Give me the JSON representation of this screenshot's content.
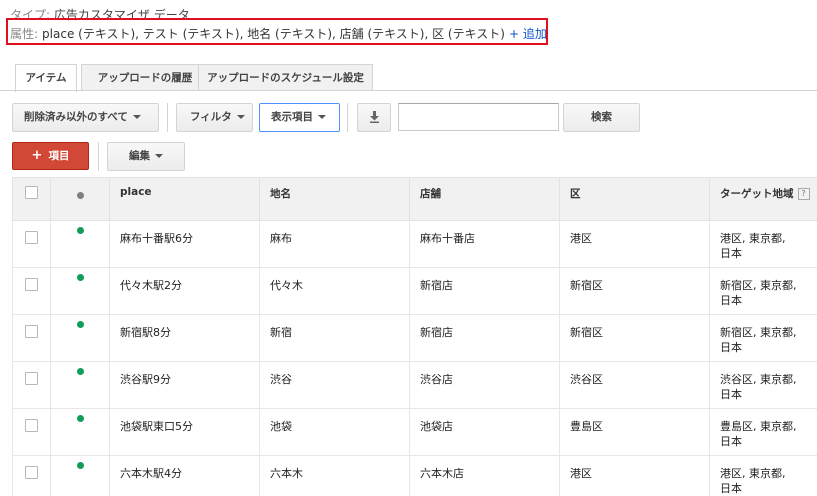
{
  "type_line": {
    "label": "タイプ:",
    "value": "広告カスタマイザ データ"
  },
  "attributes": {
    "label": "属性:",
    "value": "place (テキスト), テスト (テキスト), 地名 (テキスト), 店舗 (テキスト), 区 (テキスト)",
    "add_link": "+ 追加"
  },
  "tabs": [
    {
      "label": "アイテム",
      "active": true
    },
    {
      "label": "アップロードの履歴",
      "active": false
    },
    {
      "label": "アップロードのスケジュール設定",
      "active": false
    }
  ],
  "toolbar": {
    "filter_scope": "削除済み以外のすべて",
    "filter": "フィルタ",
    "columns": "表示項目",
    "search": "検索",
    "search_value": "",
    "add_item": "項目",
    "edit": "編集"
  },
  "table": {
    "headers": [
      "place",
      "地名",
      "店舗",
      "区",
      "ターゲット地域"
    ],
    "help_label": "?",
    "rows": [
      {
        "place": "麻布十番駅6分",
        "chimei": "麻布",
        "tenpo": "麻布十番店",
        "ku": "港区",
        "target_1": "港区, 東京都,",
        "target_2": "日本"
      },
      {
        "place": "代々木駅2分",
        "chimei": "代々木",
        "tenpo": "新宿店",
        "ku": "新宿区",
        "target_1": "新宿区, 東京都,",
        "target_2": "日本"
      },
      {
        "place": "新宿駅8分",
        "chimei": "新宿",
        "tenpo": "新宿店",
        "ku": "新宿区",
        "target_1": "新宿区, 東京都,",
        "target_2": "日本"
      },
      {
        "place": "渋谷駅9分",
        "chimei": "渋谷",
        "tenpo": "渋谷店",
        "ku": "渋谷区",
        "target_1": "渋谷区, 東京都,",
        "target_2": "日本"
      },
      {
        "place": "池袋駅東口5分",
        "chimei": "池袋",
        "tenpo": "池袋店",
        "ku": "豊島区",
        "target_1": "豊島区, 東京都,",
        "target_2": "日本"
      },
      {
        "place": "六本木駅4分",
        "chimei": "六本木",
        "tenpo": "六本木店",
        "ku": "港区",
        "target_1": "港区, 東京都,",
        "target_2": "日本"
      }
    ]
  },
  "colors": {
    "accent_red": "#d14836",
    "status_green": "#0f9d58",
    "highlight_box": "#e0101e",
    "link_blue": "#1155cc"
  }
}
